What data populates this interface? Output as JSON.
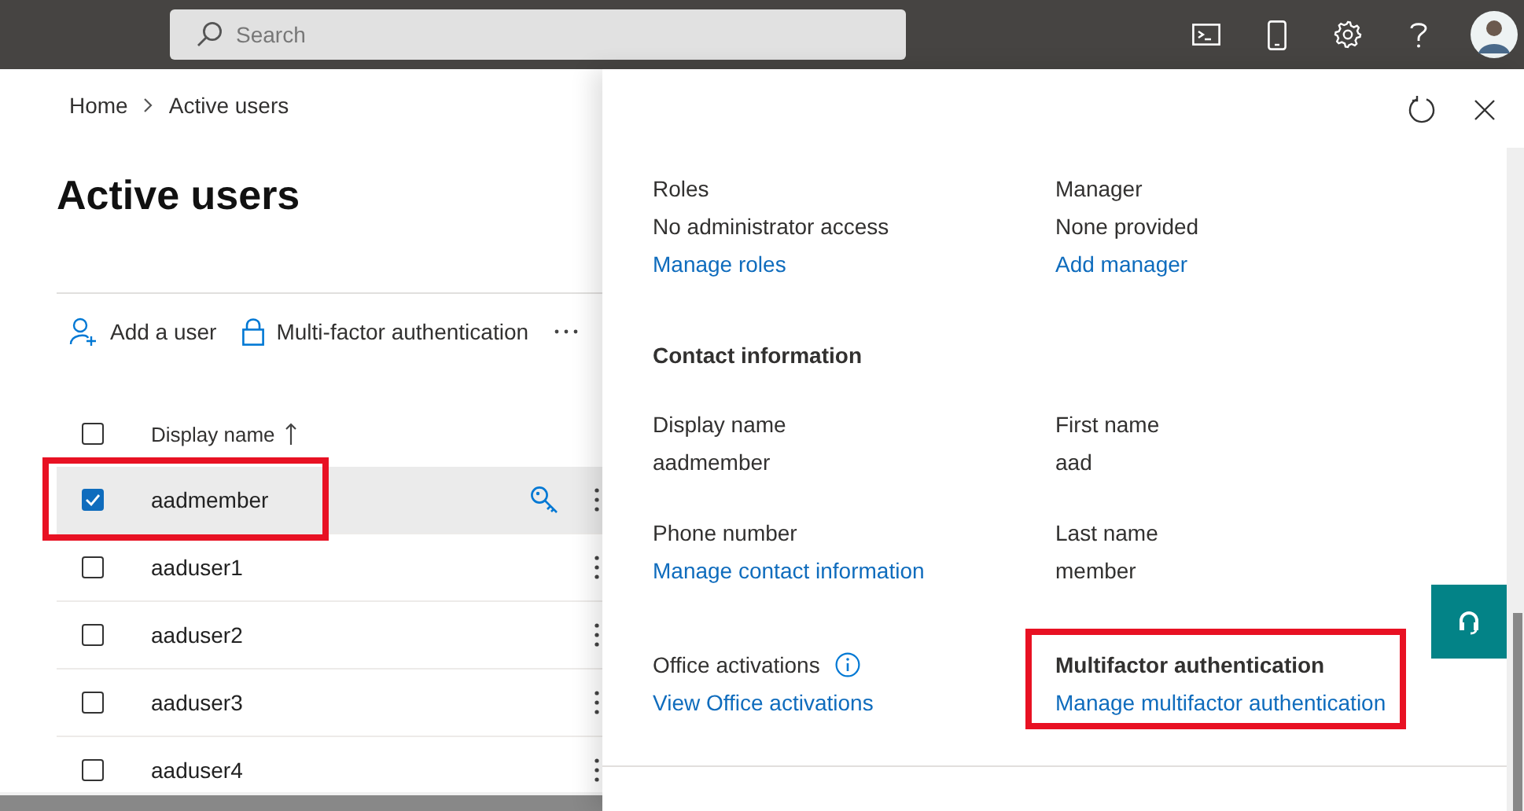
{
  "top_bar": {
    "search": {
      "placeholder": "Search"
    }
  },
  "breadcrumb": [
    "Home",
    "Active users"
  ],
  "page_title": "Active users",
  "toolbar": [
    {
      "label": "Add a user",
      "kind": "add-user"
    },
    {
      "label": "Multi-factor authentication",
      "kind": "lock"
    },
    {
      "kind": "more"
    }
  ],
  "table": {
    "select_all": {
      "checked": false
    },
    "columns": [
      {
        "label": "Display name",
        "sorted": true
      }
    ],
    "rows": [
      {
        "name": "aadmember",
        "checked": true,
        "selected": true,
        "highlighted": true
      },
      {
        "name": "aaduser1",
        "checked": false,
        "selected": false,
        "highlighted": false
      },
      {
        "name": "aaduser2",
        "checked": false,
        "selected": false,
        "highlighted": false
      },
      {
        "name": "aaduser3",
        "checked": false,
        "selected": false,
        "highlighted": false
      },
      {
        "name": "aaduser4",
        "checked": false,
        "selected": false,
        "highlighted": false
      }
    ]
  },
  "panel": {
    "fields": [
      {
        "label": "Roles",
        "value": "No administrator access",
        "link": "Manage roles"
      },
      {
        "label": "Manager",
        "value": "None provided",
        "link": "Add manager"
      }
    ],
    "contact_heading": "Contact information",
    "contact_fields": [
      {
        "label": "Display name",
        "value": "aadmember"
      },
      {
        "label": "First name",
        "value": "aad"
      },
      {
        "label": "Phone number",
        "link": "Manage contact information"
      },
      {
        "label": "Last name",
        "value": "member"
      },
      {
        "label": "Office activations",
        "info": true,
        "link": "View Office activations"
      },
      {
        "label": "Multifactor authentication",
        "bold": true,
        "highlighted": true,
        "link": "Manage multifactor authentication"
      }
    ]
  }
}
